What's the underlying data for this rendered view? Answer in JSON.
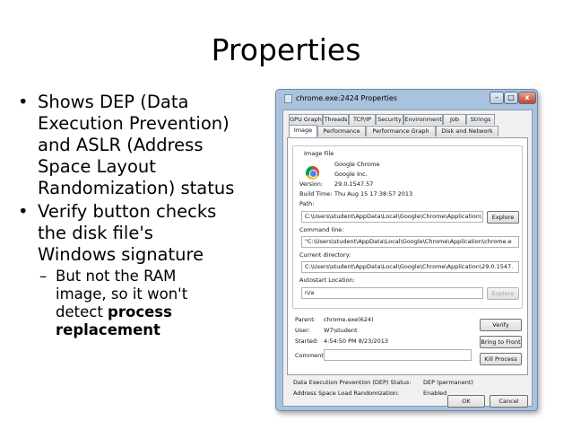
{
  "slide": {
    "title": "Properties",
    "bullets": [
      {
        "marker": "•",
        "text": "Shows DEP (Data Execution Prevention) and ASLR (Address Space Layout Randomization) status",
        "lines": [
          "Shows DEP (Data",
          "Execution Prevention)",
          "and ASLR (Address",
          "Space Layout",
          "Randomization) status"
        ]
      },
      {
        "marker": "•",
        "text": "Verify button checks the disk file's Windows signature",
        "lines": [
          "Verify button checks",
          "the disk file's",
          "Windows signature"
        ]
      }
    ],
    "sub_bullet": {
      "marker": "–",
      "line1": "But not the RAM",
      "line2": "image, so it won't",
      "line3_prefix": "detect ",
      "bold_1": "process",
      "bold_2": "replacement"
    }
  },
  "dialog": {
    "title": "chrome.exe:2424 Properties",
    "controls": {
      "minimize": "–",
      "maximize": "□",
      "close": "x"
    },
    "tabs_row1": [
      "GPU Graph",
      "Threads",
      "TCP/IP",
      "Security",
      "Environment",
      "Job",
      "Strings"
    ],
    "tabs_row2": [
      "Image",
      "Performance",
      "Performance Graph",
      "Disk and Network"
    ],
    "active_tab": "Image",
    "image_file_legend": "Image File",
    "product_name": "Google Chrome",
    "company": "Google Inc.",
    "version_label": "Version:",
    "version": "29.0.1547.57",
    "build_time_label": "Build Time:",
    "build_time": "Thu Aug 15 17:38:57 2013",
    "path_label": "Path:",
    "path": "C:\\Users\\student\\AppData\\Local\\Google\\Chrome\\Application\\",
    "explore_label": "Explore",
    "command_line_label": "Command line:",
    "command_line": "\"C:\\Users\\student\\AppData\\Local\\Google\\Chrome\\Application\\chrome.e",
    "current_dir_label": "Current directory:",
    "current_dir": "C:\\Users\\student\\AppData\\Local\\Google\\Chrome\\Application\\29.0.1547.",
    "autostart_label": "Autostart Location:",
    "autostart": "n/a",
    "parent_label": "Parent:",
    "parent": "chrome.exe(624)",
    "user_label": "User:",
    "user": "W7\\student",
    "started_label": "Started:",
    "started": "4:54:50 PM  8/23/2013",
    "comment_label": "Comment:",
    "comment": "",
    "verify_label": "Verify",
    "bring_front_label": "Bring to Front",
    "kill_label": "Kill Process",
    "dep_label": "Data Execution Prevention (DEP) Status:",
    "dep_value": "DEP (permanent)",
    "aslr_label": "Address Space Load Randomization:",
    "aslr_value": "Enabled",
    "ok_label": "OK",
    "cancel_label": "Cancel"
  }
}
